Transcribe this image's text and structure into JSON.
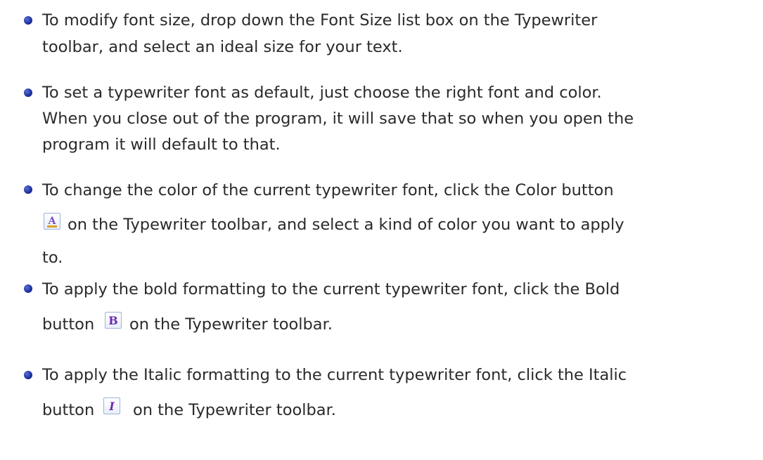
{
  "items": [
    {
      "lines": [
        "To modify font size, drop down the Font Size list box on the Typewriter",
        "toolbar, and select an ideal size for your text."
      ]
    },
    {
      "lines": [
        "To set a typewriter font as default, just choose the right font and color.",
        "When you close out of the program, it will save that so when you open the",
        "program it will default to that."
      ]
    },
    {
      "lines": [
        "To change the color of the current typewriter font, click the Color button",
        "on the Typewriter toolbar, and select a kind of color you want to apply",
        "to."
      ],
      "icon": "color-a-icon"
    },
    {
      "lines": [
        "To apply the bold formatting to the current typewriter font, click the Bold",
        "button",
        "on the Typewriter toolbar."
      ],
      "icon": "bold-b-icon"
    },
    {
      "lines": [
        "To apply the Italic formatting to the current typewriter font, click the Italic",
        "button",
        "on the Typewriter toolbar."
      ],
      "icon": "italic-i-icon"
    }
  ],
  "colors": {
    "text": "#2a2a2a",
    "bullet": "#1c2f9c",
    "icon_border": "#9fb3d8",
    "icon_glyph_color_a": "#7a4fc0",
    "icon_glyph_color_underline": "#d8a02a",
    "icon_glyph_bold": "#6a2bb0",
    "icon_glyph_italic": "#6a2bb0"
  }
}
